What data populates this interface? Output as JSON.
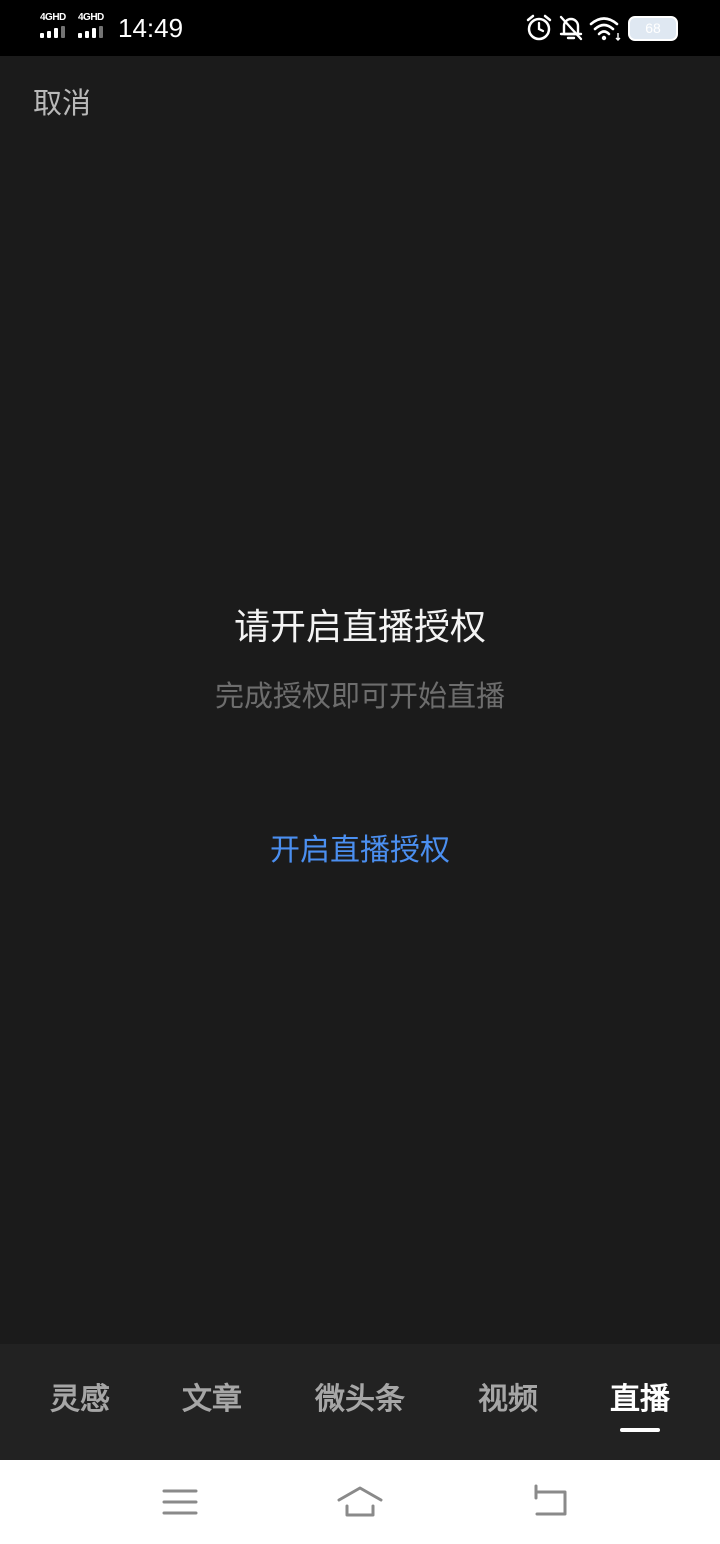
{
  "status_bar": {
    "network_1": "4GHD",
    "network_2": "4GHD",
    "time": "14:49",
    "battery": "68",
    "icons": [
      "alarm-icon",
      "mute-bell-icon",
      "wifi-icon",
      "battery-icon"
    ]
  },
  "header": {
    "cancel_label": "取消"
  },
  "main": {
    "title": "请开启直播授权",
    "subtitle": "完成授权即可开始直播",
    "auth_button_label": "开启直播授权"
  },
  "tabs": [
    {
      "label": "灵感",
      "active": false
    },
    {
      "label": "文章",
      "active": false
    },
    {
      "label": "微头条",
      "active": false
    },
    {
      "label": "视频",
      "active": false
    },
    {
      "label": "直播",
      "active": true
    }
  ],
  "nav": {
    "icons": [
      "menu-icon",
      "home-icon",
      "back-icon"
    ]
  },
  "colors": {
    "background": "#1b1b1b",
    "accent": "#4b8ff0",
    "tab_bar": "#222222"
  }
}
